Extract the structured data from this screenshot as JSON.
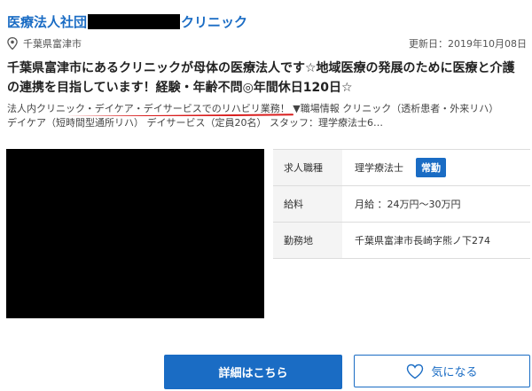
{
  "listing": {
    "org_prefix": "医療法人社団",
    "org_suffix": "クリニック",
    "location": "千葉県富津市",
    "updated": "更新日：2019年10月08日",
    "headline": "千葉県富津市にあるクリニックが母体の医療法人です☆地域医療の発展のために医療と介護の連携を目指しています！経験・年齢不問◎年間休日120日☆",
    "summary_highlight": "法人内クリニック・デイケア・デイサービスでのリハビリ業務！",
    "summary_line1_rest": "▼職場情報 クリニック（透析患者・外来リハ）",
    "summary_line2": "デイケア（短時間型通所リハ） デイサービス（定員20名） スタッフ：理学療法士6…"
  },
  "info": {
    "job_label": "求人職種",
    "job_value": "理学療法士",
    "job_badge": "常勤",
    "salary_label": "給料",
    "salary_value": "月給 ：24万円～30万円",
    "location_label": "勤務地",
    "location_value": "千葉県富津市長崎字熊ノ下274"
  },
  "buttons": {
    "detail": "詳細はこちら",
    "favorite": "気になる"
  },
  "colors": {
    "accent": "#1a6cc4",
    "highlight_underline": "#d81e1e"
  },
  "icons": {
    "location": "map-pin-icon",
    "favorite": "heart-outline-icon"
  }
}
